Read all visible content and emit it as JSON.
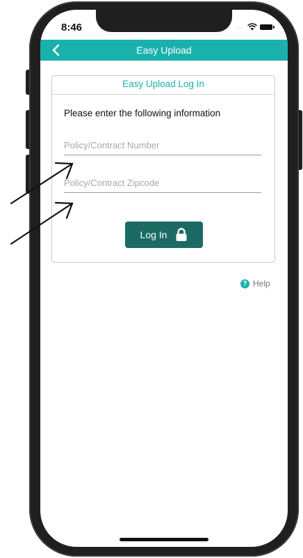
{
  "status_bar": {
    "time": "8:46",
    "signal": "....",
    "icons": [
      "signal-dots",
      "wifi-icon",
      "battery-icon"
    ]
  },
  "navbar": {
    "title": "Easy Upload",
    "back_icon": "chevron-left-icon",
    "background_color": "#1ab1ad"
  },
  "login_card": {
    "title": "Easy Upload Log In",
    "instructions": "Please enter the following information",
    "policy_field": {
      "placeholder": "Policy/Contract Number",
      "value": ""
    },
    "zipcode_field": {
      "placeholder": "Policy/Contract Zipcode",
      "value": ""
    },
    "login_button": {
      "label": "Log In",
      "icon": "lock-icon",
      "color": "#1b6b64"
    }
  },
  "help": {
    "label": "Help",
    "icon": "question-circle-icon"
  },
  "annotations": {
    "arrow_count": 2,
    "arrow_icon": "arrow-icon"
  }
}
